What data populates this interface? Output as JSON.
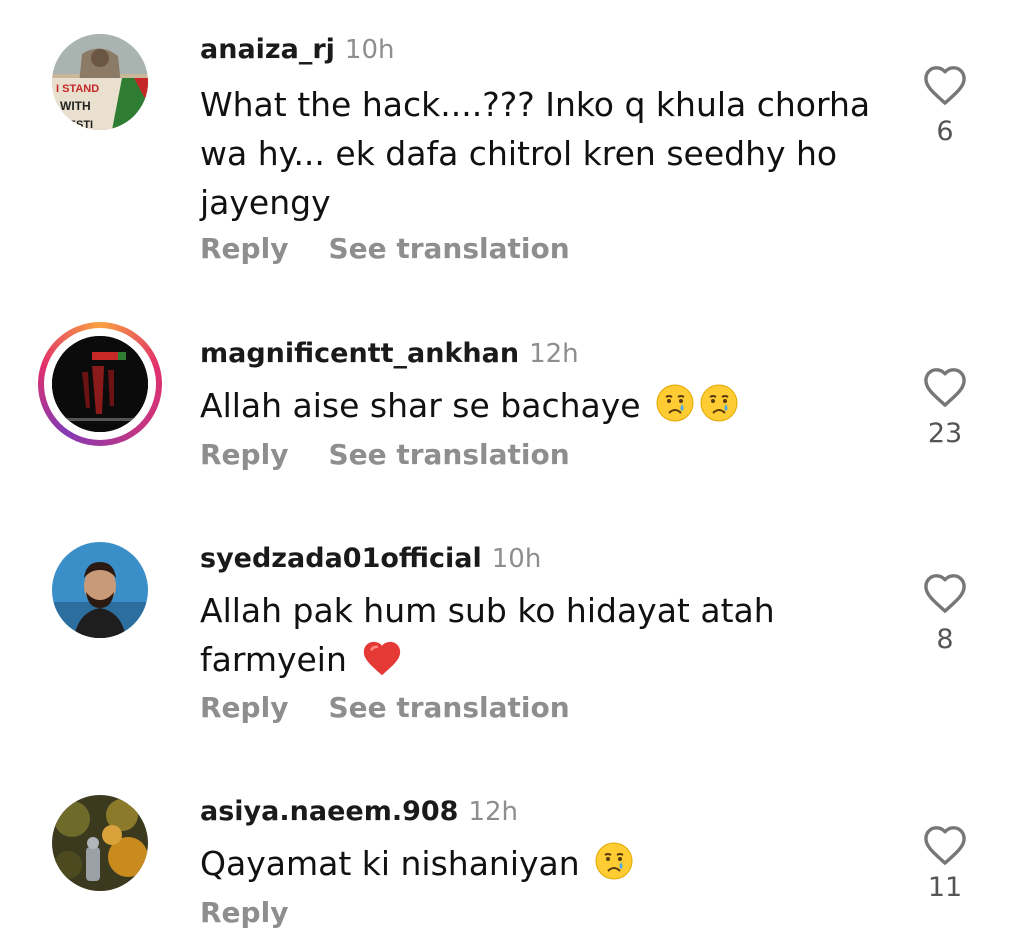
{
  "comments": [
    {
      "username": "anaiza_rj",
      "time": "10h",
      "text": "What the hack....??? Inko q khula chorha wa hy... ek dafa chitrol kren seedhy ho jayengy",
      "reply": "Reply",
      "translate": "See translation",
      "likes": "6",
      "avatar_text": [
        "I STAND",
        "WITH",
        "ALESTI"
      ]
    },
    {
      "username": "magnificentt_ankhan",
      "time": "12h",
      "text": "Allah aise shar se bachaye",
      "emojis": [
        "crying-face-icon",
        "crying-face-icon"
      ],
      "reply": "Reply",
      "translate": "See translation",
      "likes": "23",
      "avatar_story_ring": true
    },
    {
      "username": "syedzada01official",
      "time": "10h",
      "text": "Allah pak hum sub ko hidayat atah farmyein",
      "emojis": [
        "red-heart-icon"
      ],
      "reply": "Reply",
      "translate": "See translation",
      "likes": "8"
    },
    {
      "username": "asiya.naeem.908",
      "time": "12h",
      "text": "Qayamat ki nishaniyan",
      "emojis": [
        "crying-face-icon"
      ],
      "reply": "Reply",
      "likes": "11"
    }
  ],
  "colors": {
    "username": "#1a1a1a",
    "secondary_text": "#8e8e8e",
    "like_icon": "#777777",
    "story_ring": [
      "#f9a03f",
      "#e1306c",
      "#833ab4"
    ]
  }
}
